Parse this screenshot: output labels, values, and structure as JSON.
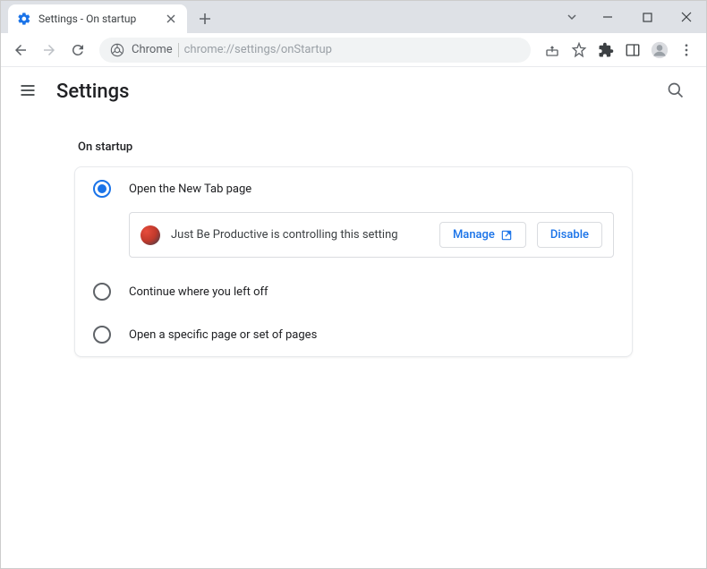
{
  "window": {
    "tab_title": "Settings - On startup"
  },
  "omnibox": {
    "host": "Chrome",
    "path": "chrome://settings/onStartup"
  },
  "header": {
    "title": "Settings"
  },
  "section": {
    "title": "On startup"
  },
  "options": {
    "new_tab": "Open the New Tab page",
    "continue": "Continue where you left off",
    "specific": "Open a specific page or set of pages"
  },
  "extension_notice": {
    "text": "Just Be Productive is controlling this setting",
    "manage": "Manage",
    "disable": "Disable"
  }
}
